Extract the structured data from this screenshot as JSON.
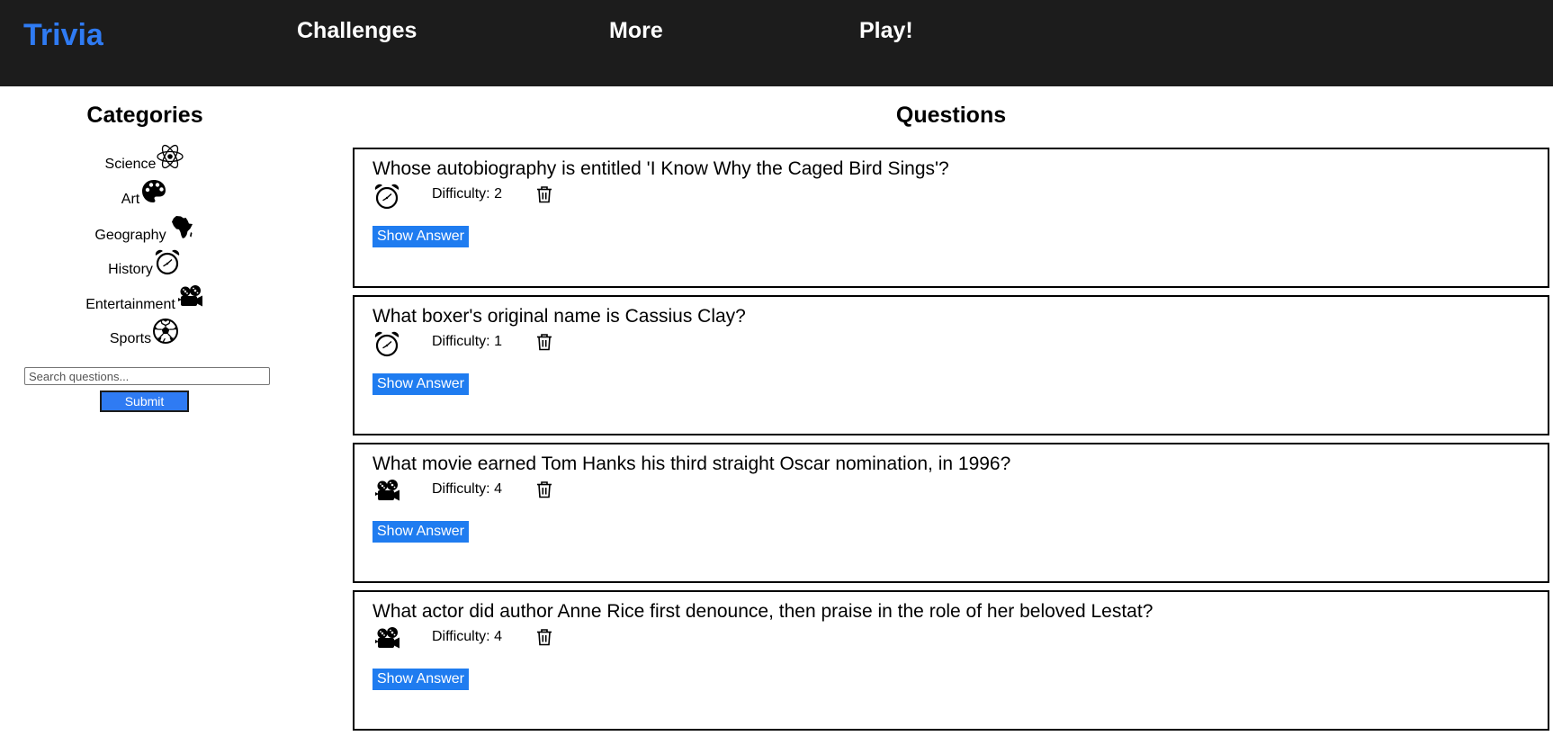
{
  "nav": {
    "brand": "Trivia",
    "links": [
      "Challenges",
      "More",
      "Play!"
    ]
  },
  "sidebar": {
    "title": "Categories",
    "categories": [
      {
        "label": "Science",
        "icon": "atom-icon"
      },
      {
        "label": "Art",
        "icon": "palette-icon"
      },
      {
        "label": "Geography",
        "icon": "africa-icon"
      },
      {
        "label": "History",
        "icon": "alarm-clock-icon"
      },
      {
        "label": "Entertainment",
        "icon": "film-camera-icon"
      },
      {
        "label": "Sports",
        "icon": "soccer-ball-icon"
      }
    ],
    "search": {
      "placeholder": "Search questions...",
      "value": ""
    },
    "submit_label": "Submit"
  },
  "main": {
    "title": "Questions",
    "questions": [
      {
        "text": "Whose autobiography is entitled 'I Know Why the Caged Bird Sings'?",
        "icon": "alarm-clock-icon",
        "difficulty_label": "Difficulty: ",
        "difficulty": "2",
        "button": "Show Answer"
      },
      {
        "text": "What boxer's original name is Cassius Clay?",
        "icon": "alarm-clock-icon",
        "difficulty_label": "Difficulty: ",
        "difficulty": "1",
        "button": "Show Answer"
      },
      {
        "text": "What movie earned Tom Hanks his third straight Oscar nomination, in 1996?",
        "icon": "film-camera-icon",
        "difficulty_label": "Difficulty: ",
        "difficulty": "4",
        "button": "Show Answer"
      },
      {
        "text": "What actor did author Anne Rice first denounce, then praise in the role of her beloved Lestat?",
        "icon": "film-camera-icon",
        "difficulty_label": "Difficulty: ",
        "difficulty": "4",
        "button": "Show Answer"
      }
    ]
  },
  "colors": {
    "navbar_bg": "#1c1c1c",
    "brand": "#2f7bf3",
    "button_bg": "#1f7cf0"
  }
}
